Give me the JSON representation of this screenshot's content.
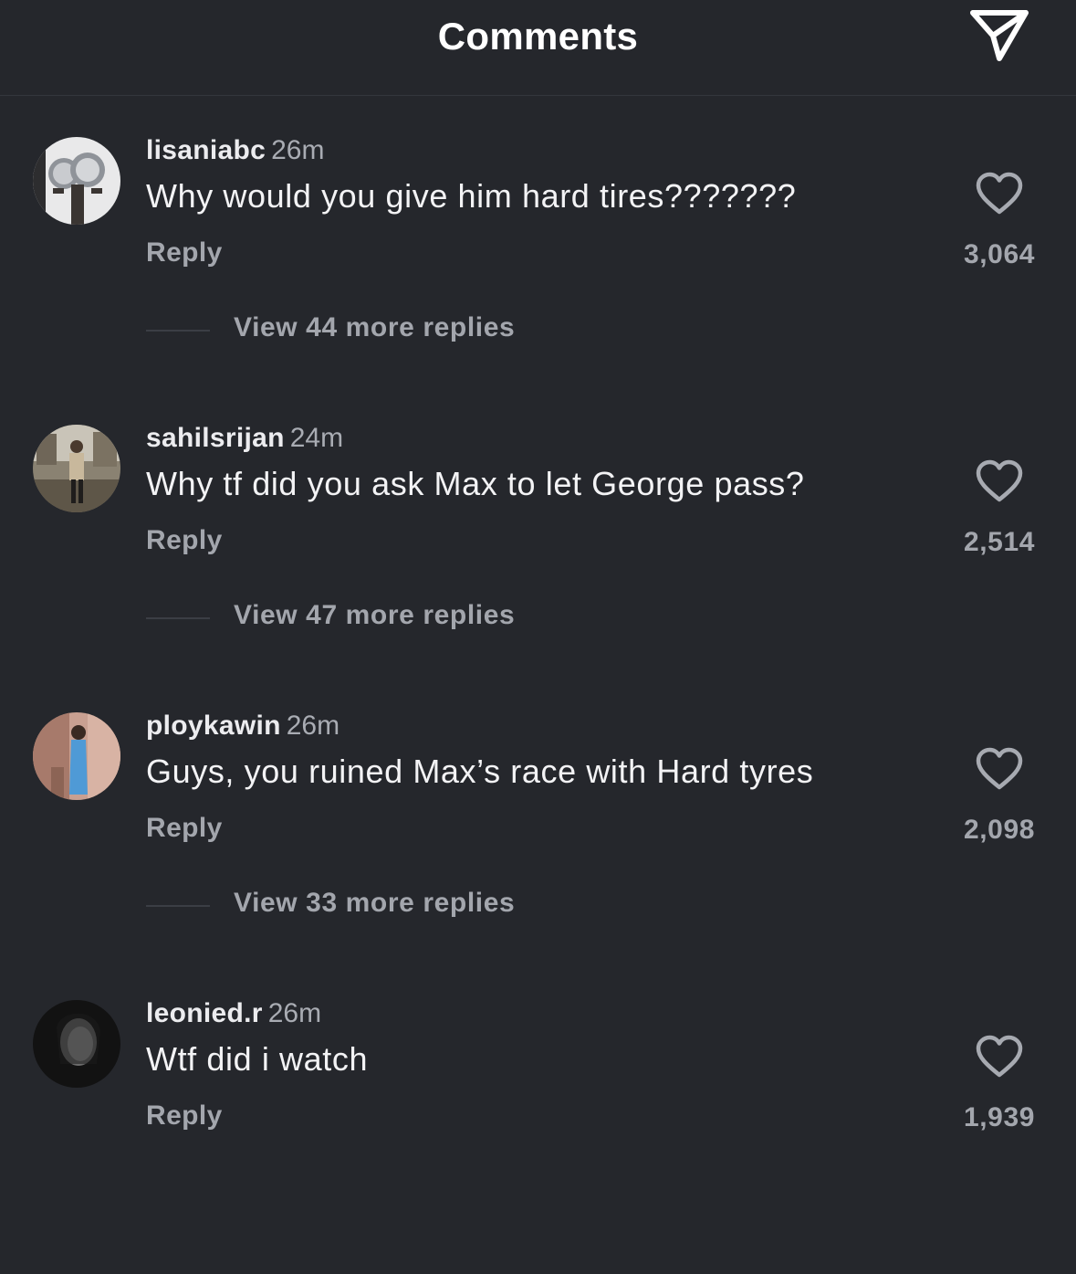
{
  "header": {
    "title": "Comments",
    "share_icon": "paper-plane-icon"
  },
  "colors": {
    "background": "#25272c",
    "primary_text": "#f3f3f5",
    "secondary_text": "#a3a6ad"
  },
  "comments": [
    {
      "username": "lisaniabc",
      "time": "26m",
      "text": "Why would you give him hard tires???????",
      "reply_label": "Reply",
      "likes": "3,064",
      "like_icon": "heart-outline-icon",
      "view_replies": "View 44 more replies"
    },
    {
      "username": "sahilsrijan",
      "time": "24m",
      "text": "Why tf did you ask Max to let George pass?",
      "reply_label": "Reply",
      "likes": "2,514",
      "like_icon": "heart-outline-icon",
      "view_replies": "View 47 more replies"
    },
    {
      "username": "ploykawin",
      "time": "26m",
      "text": "Guys, you ruined Max’s race with Hard tyres",
      "reply_label": "Reply",
      "likes": "2,098",
      "like_icon": "heart-outline-icon",
      "view_replies": "View 33 more replies"
    },
    {
      "username": "leonied.r",
      "time": "26m",
      "text": "Wtf did i watch",
      "reply_label": "Reply",
      "likes": "1,939",
      "like_icon": "heart-outline-icon"
    }
  ]
}
